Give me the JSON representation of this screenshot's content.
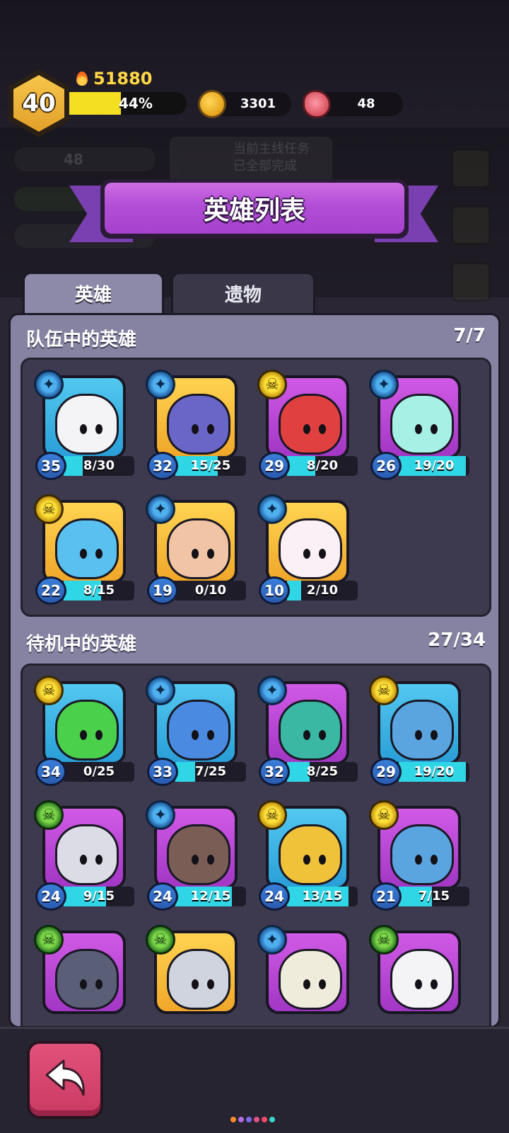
{
  "player": {
    "level": "40",
    "power": "51880",
    "xp_label": "44%",
    "xp_fraction": 0.44
  },
  "resources": {
    "coins": "3301",
    "meat": "48"
  },
  "background": {
    "meat_value": "48",
    "quest_text_line1": "当前主线任务",
    "quest_text_line2": "已全部完成"
  },
  "title": "英雄列表",
  "tabs": [
    {
      "label": "英雄",
      "active": true
    },
    {
      "label": "遗物",
      "active": false
    }
  ],
  "team_section": {
    "title": "队伍中的英雄",
    "count": "7/7",
    "heroes": [
      {
        "level": "35",
        "progress": "8/30",
        "fill": 0.27,
        "rarity": "blue",
        "badge": "blue",
        "icon": "snowman-hero-icon",
        "face": "#f4f4f6"
      },
      {
        "level": "32",
        "progress": "15/25",
        "fill": 0.6,
        "rarity": "yellow",
        "badge": "blue",
        "icon": "dark-knight-hero-icon",
        "face": "#6a66c8"
      },
      {
        "level": "29",
        "progress": "8/20",
        "fill": 0.4,
        "rarity": "purple",
        "badge": "yellow",
        "icon": "green-hat-ninja-hero-icon",
        "face": "#e04040"
      },
      {
        "level": "26",
        "progress": "19/20",
        "fill": 0.95,
        "rarity": "purple",
        "badge": "blue",
        "icon": "bunny-hero-icon",
        "face": "#a6f0e6"
      },
      {
        "level": "22",
        "progress": "8/15",
        "fill": 0.53,
        "rarity": "yellow",
        "badge": "yellow",
        "icon": "crested-bird-hero-icon",
        "face": "#5ac0f0"
      },
      {
        "level": "19",
        "progress": "0/10",
        "fill": 0.0,
        "rarity": "yellow",
        "badge": "blue",
        "icon": "pharaoh-hero-icon",
        "face": "#f0c4a4"
      },
      {
        "level": "10",
        "progress": "2/10",
        "fill": 0.2,
        "rarity": "yellow",
        "badge": "blue",
        "icon": "pink-bow-hero-icon",
        "face": "#fbf0f6"
      }
    ]
  },
  "standby_section": {
    "title": "待机中的英雄",
    "count": "27/34",
    "heroes": [
      {
        "level": "34",
        "progress": "0/25",
        "fill": 0.0,
        "rarity": "blue",
        "badge": "yellow",
        "icon": "witch-hat-slime-hero-icon",
        "face": "#4ad04a"
      },
      {
        "level": "33",
        "progress": "7/25",
        "fill": 0.28,
        "rarity": "blue",
        "badge": "blue",
        "icon": "spiked-helmet-hero-icon",
        "face": "#4a8ae0"
      },
      {
        "level": "32",
        "progress": "8/25",
        "fill": 0.32,
        "rarity": "purple",
        "badge": "blue",
        "icon": "dino-hero-icon",
        "face": "#3ab8a4"
      },
      {
        "level": "29",
        "progress": "19/20",
        "fill": 0.95,
        "rarity": "blue",
        "badge": "yellow",
        "icon": "horned-knight-hero-icon",
        "face": "#5aa4e0"
      },
      {
        "level": "24",
        "progress": "9/15",
        "fill": 0.6,
        "rarity": "purple",
        "badge": "green",
        "icon": "robot-hero-icon",
        "face": "#dcdce6"
      },
      {
        "level": "24",
        "progress": "12/15",
        "fill": 0.8,
        "rarity": "purple",
        "badge": "blue",
        "icon": "antler-hero-icon",
        "face": "#7a5e56"
      },
      {
        "level": "24",
        "progress": "13/15",
        "fill": 0.87,
        "rarity": "blue",
        "badge": "yellow",
        "icon": "dino-costume-hero-icon",
        "face": "#f0c23a"
      },
      {
        "level": "21",
        "progress": "7/15",
        "fill": 0.47,
        "rarity": "purple",
        "badge": "yellow",
        "icon": "skull-wizard-hero-icon",
        "face": "#5aa4e0"
      },
      {
        "level": "",
        "progress": "",
        "fill": 0.0,
        "rarity": "purple",
        "badge": "green",
        "icon": "shark-hero-icon",
        "face": "#5a5e76"
      },
      {
        "level": "",
        "progress": "",
        "fill": 0.0,
        "rarity": "yellow",
        "badge": "green",
        "icon": "armored-beast-hero-icon",
        "face": "#d0d4de"
      },
      {
        "level": "",
        "progress": "",
        "fill": 0.0,
        "rarity": "purple",
        "badge": "blue",
        "icon": "mummy-hero-icon",
        "face": "#f0ecdc"
      },
      {
        "level": "",
        "progress": "",
        "fill": 0.0,
        "rarity": "purple",
        "badge": "green",
        "icon": "leaf-sprout-hero-icon",
        "face": "#f4f4f6"
      }
    ]
  },
  "colors": {
    "panel": "#8683a2",
    "grid_box": "#3d3a50",
    "progress_fill": "#2fd6e6",
    "title_banner": "#b24ed6",
    "back_button": "#d9456e"
  },
  "page_indicator_colors": [
    "#ff8a2a",
    "#b46ee0",
    "#7e6ae8",
    "#e0508a",
    "#ff4a6a",
    "#3ad6c8"
  ]
}
